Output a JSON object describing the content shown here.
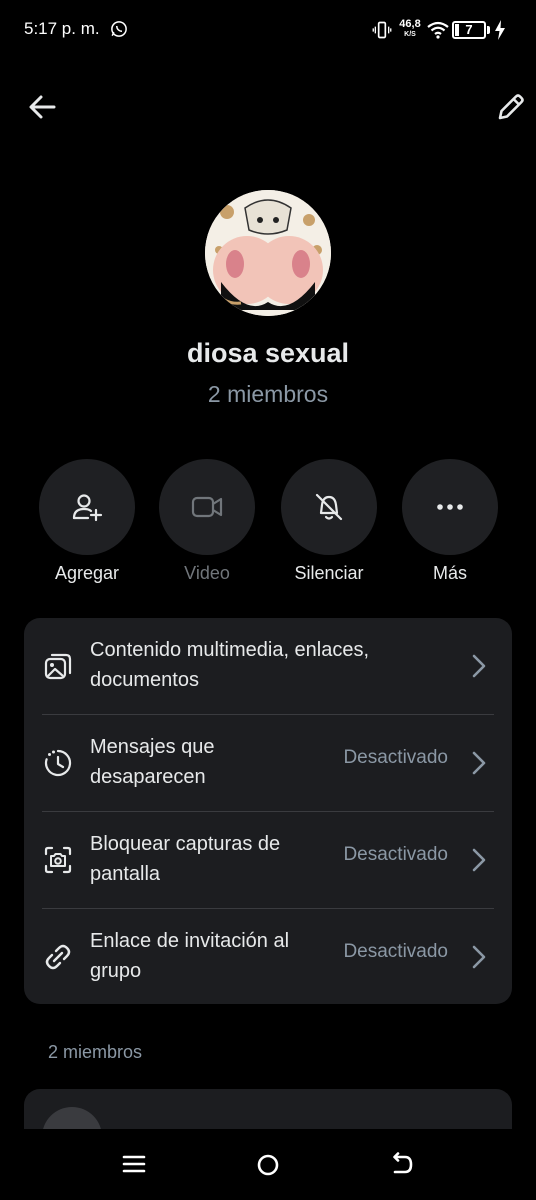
{
  "status_bar": {
    "time": "5:17 p. m.",
    "net_speed_value": "46,8",
    "net_speed_unit": "K/S",
    "battery_level": "7"
  },
  "header": {
    "back_icon": "arrow-left-icon",
    "edit_icon": "pencil-icon"
  },
  "group": {
    "name": "diosa sexual",
    "member_count": "2 miembros"
  },
  "actions": [
    {
      "label": "Agregar",
      "icon": "add-person-icon",
      "enabled": true
    },
    {
      "label": "Video",
      "icon": "video-icon",
      "enabled": false
    },
    {
      "label": "Silenciar",
      "icon": "bell-off-icon",
      "enabled": true
    },
    {
      "label": "Más",
      "icon": "more-dots-icon",
      "enabled": true
    }
  ],
  "settings": [
    {
      "title": "Contenido multimedia, enlaces, documentos",
      "value": "",
      "icon": "media-icon"
    },
    {
      "title": "Mensajes que desaparecen",
      "value": "Desactivado",
      "icon": "timer-icon"
    },
    {
      "title": "Bloquear capturas de pantalla",
      "value": "Desactivado",
      "icon": "screenshot-camera-icon"
    },
    {
      "title": "Enlace de invitación al grupo",
      "value": "Desactivado",
      "icon": "link-icon"
    }
  ],
  "members_section": {
    "label": "2 miembros"
  },
  "colors": {
    "background": "#000000",
    "card": "#1c1d20",
    "circle_button": "#1f2023",
    "primary_text": "#e7e9ea",
    "secondary_text": "#8b98a5"
  }
}
